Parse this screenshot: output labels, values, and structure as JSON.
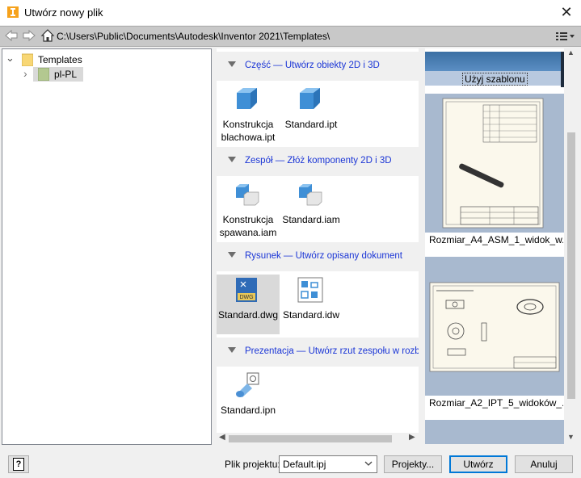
{
  "window": {
    "title": "Utwórz nowy plik",
    "close_glyph": "✕"
  },
  "pathbar": {
    "path": "C:\\Users\\Public\\Documents\\Autodesk\\Inventor 2021\\Templates\\"
  },
  "tree": {
    "items": [
      {
        "label": "Templates",
        "expander": "⌄"
      },
      {
        "label": "pl-PL",
        "expander": "›"
      }
    ]
  },
  "sections": [
    {
      "title": "Część — Utwórz obiekty 2D i 3D",
      "files": [
        {
          "label": "Konstrukcja blachowa.ipt",
          "icon": "part-icon"
        },
        {
          "label": "Standard.ipt",
          "icon": "part-icon"
        }
      ]
    },
    {
      "title": "Zespół — Złóż komponenty 2D i 3D",
      "files": [
        {
          "label": "Konstrukcja spawana.iam",
          "icon": "assembly-icon"
        },
        {
          "label": "Standard.iam",
          "icon": "assembly-icon"
        }
      ]
    },
    {
      "title": "Rysunek — Utwórz opisany dokument",
      "files": [
        {
          "label": "Standard.dwg",
          "icon": "dwg-icon",
          "badge": "DWG"
        },
        {
          "label": "Standard.idw",
          "icon": "idw-icon"
        }
      ]
    },
    {
      "title": "Prezentacja — Utwórz rzut zespołu w rozbiciu",
      "files": [
        {
          "label": "Standard.ipn",
          "icon": "presentation-icon"
        }
      ]
    }
  ],
  "preview": {
    "use_template_label": "Użyj szablonu",
    "thumbnails": [
      {
        "caption": "Rozmiar_A4_ASM_1_widok_w..."
      },
      {
        "caption": "Rozmiar_A2_IPT_5_widoków_..."
      }
    ]
  },
  "footer": {
    "help_glyph": "?",
    "project_label": "Plik projektu:",
    "project_value": "Default.ipj",
    "projects_button": "Projekty...",
    "create_button": "Utwórz",
    "cancel_button": "Anuluj"
  }
}
